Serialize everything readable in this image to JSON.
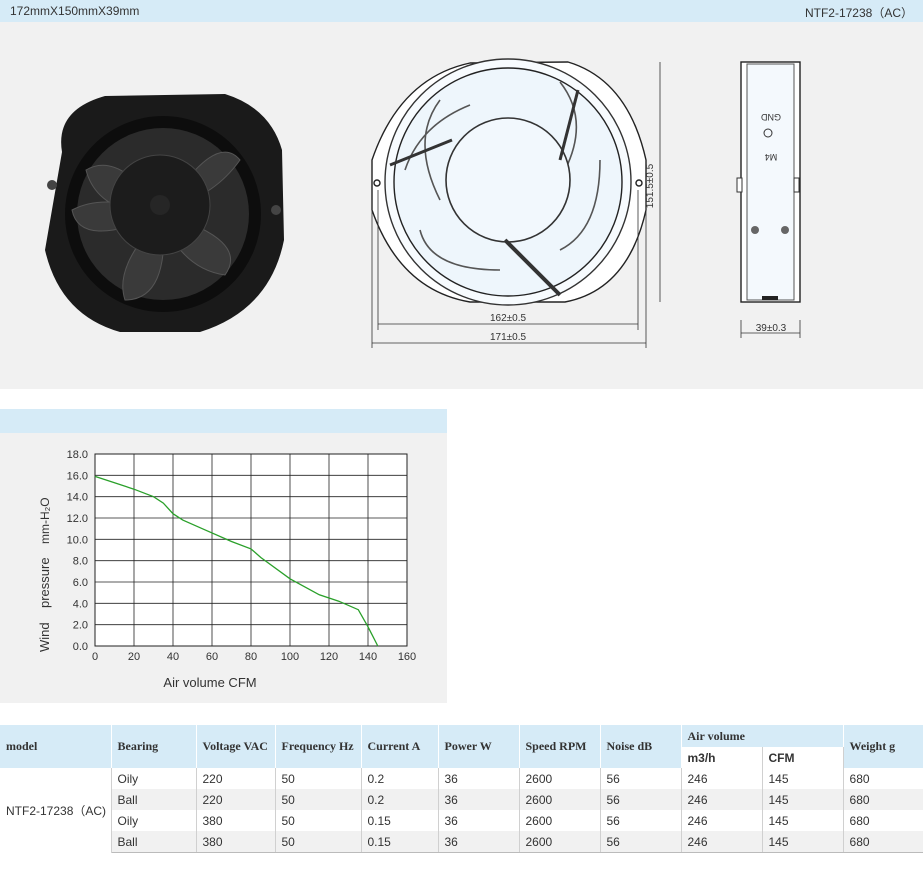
{
  "header": {
    "dimensions": "172mmX150mmX39mm",
    "model_code": "NTF2-17238（AC）"
  },
  "drawing": {
    "height_dim": "151.5±0.5",
    "inner_width_dim": "162±0.5",
    "outer_width_dim": "171±0.5",
    "depth_dim": "39±0.3",
    "gnd_label": "GND",
    "m4_label": "M4"
  },
  "chart_data": {
    "type": "line",
    "xlabel": "Air volume CFM",
    "ylabel_word1": "Wind",
    "ylabel_word2": "pressure",
    "ylabel_unit": "mm-H₂O",
    "x_ticks": [
      "0",
      "20",
      "40",
      "60",
      "80",
      "100",
      "120",
      "140",
      "160"
    ],
    "y_ticks": [
      "0.0",
      "2.0",
      "4.0",
      "6.0",
      "8.0",
      "10.0",
      "12.0",
      "14.0",
      "16.0",
      "18.0"
    ],
    "xlim": [
      0,
      160
    ],
    "ylim": [
      0,
      18
    ],
    "grid": true,
    "series": [
      {
        "color": "#2aa02a",
        "x": [
          0,
          10,
          20,
          30,
          35,
          40,
          45,
          55,
          70,
          80,
          85,
          100,
          115,
          125,
          135,
          140,
          145
        ],
        "y": [
          15.9,
          15.3,
          14.7,
          14.0,
          13.4,
          12.4,
          11.8,
          11.0,
          9.8,
          9.1,
          8.3,
          6.3,
          4.8,
          4.2,
          3.4,
          1.8,
          0.0
        ]
      }
    ]
  },
  "table": {
    "headers": {
      "model": "model",
      "bearing": "Bearing",
      "voltage": "Voltage VAC",
      "frequency": "Frequency Hz",
      "current": "Current A",
      "power": "Power W",
      "speed": "Speed RPM",
      "noise": "Noise dB",
      "air_volume": "Air volume",
      "m3h": "m3/h",
      "cfm": "CFM",
      "weight": "Weight g"
    },
    "model_value": "NTF2-17238（AC)",
    "rows": [
      {
        "bearing": "Oily",
        "voltage": "220",
        "frequency": "50",
        "current": "0.2",
        "power": "36",
        "speed": "2600",
        "noise": "56",
        "m3h": "246",
        "cfm": "145",
        "weight": "680"
      },
      {
        "bearing": "Ball",
        "voltage": "220",
        "frequency": "50",
        "current": "0.2",
        "power": "36",
        "speed": "2600",
        "noise": "56",
        "m3h": "246",
        "cfm": "145",
        "weight": "680"
      },
      {
        "bearing": "Oily",
        "voltage": "380",
        "frequency": "50",
        "current": "0.15",
        "power": "36",
        "speed": "2600",
        "noise": "56",
        "m3h": "246",
        "cfm": "145",
        "weight": "680"
      },
      {
        "bearing": "Ball",
        "voltage": "380",
        "frequency": "50",
        "current": "0.15",
        "power": "36",
        "speed": "2600",
        "noise": "56",
        "m3h": "246",
        "cfm": "145",
        "weight": "680"
      }
    ]
  }
}
